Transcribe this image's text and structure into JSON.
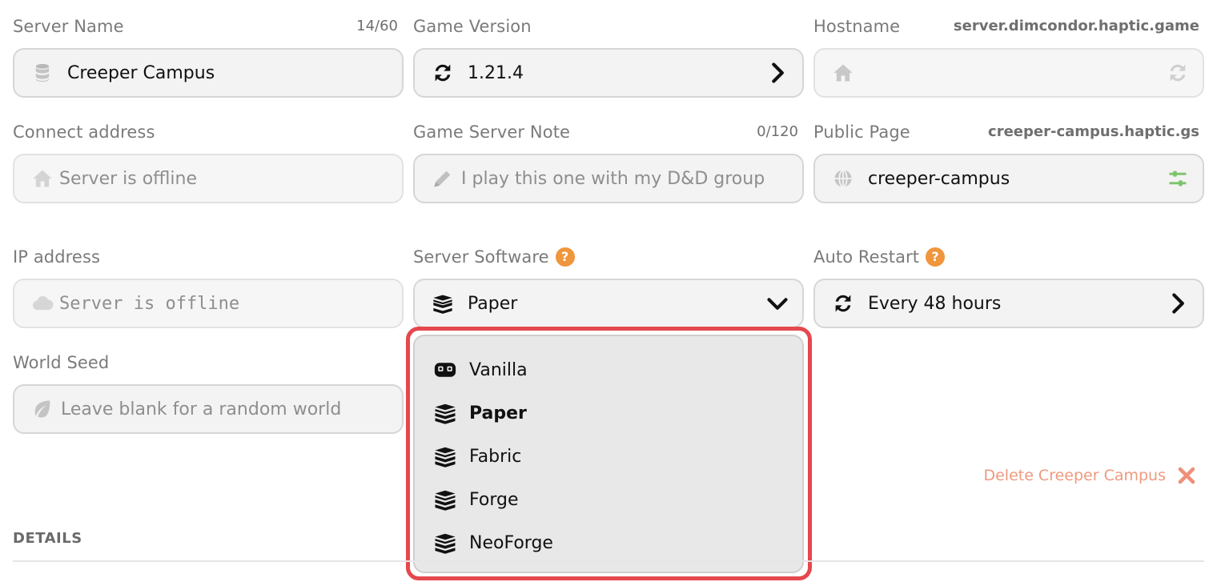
{
  "fields": {
    "server_name": {
      "label": "Server Name",
      "counter": "14/60",
      "value": "Creeper Campus"
    },
    "game_version": {
      "label": "Game Version",
      "value": "1.21.4"
    },
    "hostname": {
      "label": "Hostname",
      "meta": "server.dimcondor.haptic.game",
      "value": ""
    },
    "connect_address": {
      "label": "Connect address",
      "placeholder": "Server is offline"
    },
    "game_server_note": {
      "label": "Game Server Note",
      "counter": "0/120",
      "placeholder": "I play this one with my D&D group"
    },
    "public_page": {
      "label": "Public Page",
      "meta": "creeper-campus.haptic.gs",
      "value": "creeper-campus"
    },
    "ip_address": {
      "label": "IP address",
      "placeholder": "Server is offline"
    },
    "server_software": {
      "label": "Server Software",
      "help": "?",
      "value": "Paper"
    },
    "auto_restart": {
      "label": "Auto Restart",
      "help": "?",
      "value": "Every 48 hours"
    },
    "world_seed": {
      "label": "World Seed",
      "placeholder": "Leave blank for a random world"
    }
  },
  "software_options": [
    {
      "label": "Vanilla",
      "icon": "gamepad-icon"
    },
    {
      "label": "Paper",
      "icon": "stack-icon",
      "selected": true
    },
    {
      "label": "Fabric",
      "icon": "stack-icon"
    },
    {
      "label": "Forge",
      "icon": "stack-icon"
    },
    {
      "label": "NeoForge",
      "icon": "stack-icon"
    }
  ],
  "delete": {
    "label": "Delete Creeper Campus"
  },
  "section": {
    "title": "DETAILS"
  },
  "colors": {
    "accent_orange": "#f0963c",
    "highlight_red": "#e5484d",
    "delete_text": "#ee9a7e",
    "green_icon": "#7cc36b"
  }
}
